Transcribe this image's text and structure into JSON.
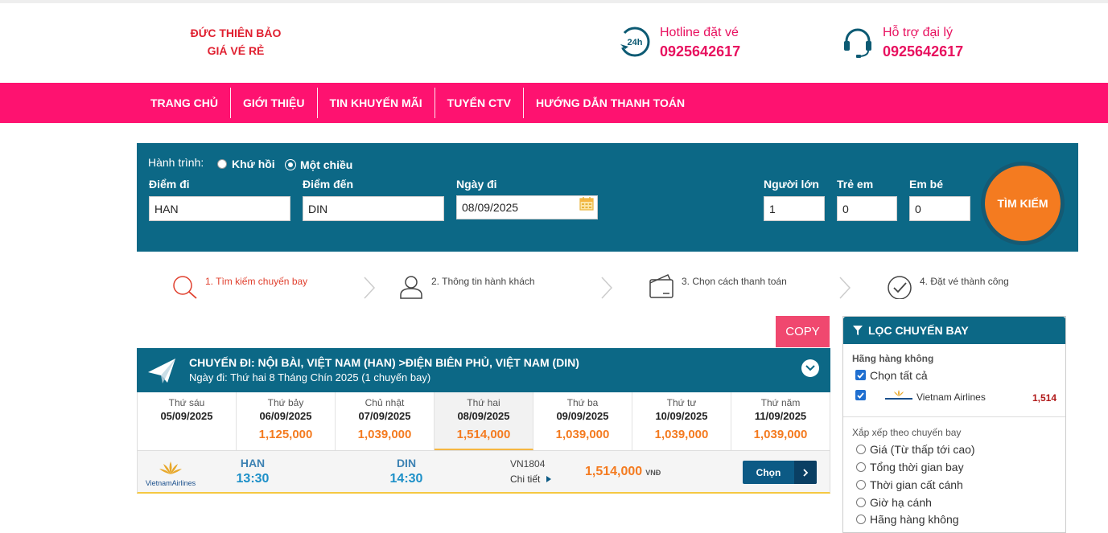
{
  "header": {
    "logo_line1": "ĐỨC THIÊN BẢO",
    "logo_line2": "GIÁ VÉ RẺ",
    "hotline_label": "Hotline đặt vé",
    "hotline_phone": "0925642617",
    "support_label": "Hỗ trợ đại lý",
    "support_phone": "0925642617",
    "hotline_icon": "24h-phone-icon",
    "support_icon": "headset-icon"
  },
  "nav": [
    "TRANG CHỦ",
    "GIỚI THIỆU",
    "TIN KHUYẾN MÃI",
    "TUYỂN CTV",
    "HƯỚNG DẪN THANH TOÁN"
  ],
  "search": {
    "trip_label": "Hành trình:",
    "round_trip": "Khứ hồi",
    "one_way": "Một chiều",
    "from_label": "Điểm đi",
    "from_value": "HAN",
    "to_label": "Điểm đến",
    "to_value": "DIN",
    "date_label": "Ngày đi",
    "date_value": "08/09/2025",
    "adult_label": "Người lớn",
    "adult_value": "1",
    "child_label": "Trẻ em",
    "child_value": "0",
    "infant_label": "Em bé",
    "infant_value": "0",
    "button": "TÌM KIẾM"
  },
  "steps": [
    "1. Tìm kiếm chuyến bay",
    "2. Thông tin hành khách",
    "3. Chọn cách thanh toán",
    "4. Đặt vé thành công"
  ],
  "copy_button": "COPY",
  "flight": {
    "title": "CHUYẾN ĐI: NỘI BÀI, VIỆT NAM (HAN) >ĐIỆN BIÊN PHỦ, VIỆT NAM (DIN)",
    "subtitle": "Ngày đi: Thứ hai 8 Tháng Chín 2025 (1 chuyến bay)",
    "days": [
      {
        "name": "Thứ sáu",
        "date": "05/09/2025",
        "price": ""
      },
      {
        "name": "Thứ bảy",
        "date": "06/09/2025",
        "price": "1,125,000"
      },
      {
        "name": "Chủ nhật",
        "date": "07/09/2025",
        "price": "1,039,000"
      },
      {
        "name": "Thứ hai",
        "date": "08/09/2025",
        "price": "1,514,000"
      },
      {
        "name": "Thứ ba",
        "date": "09/09/2025",
        "price": "1,039,000"
      },
      {
        "name": "Thứ tư",
        "date": "10/09/2025",
        "price": "1,039,000"
      },
      {
        "name": "Thứ năm",
        "date": "11/09/2025",
        "price": "1,039,000"
      }
    ],
    "row": {
      "airline": "VietnamAirlines",
      "from_code": "HAN",
      "from_time": "13:30",
      "to_code": "DIN",
      "to_time": "14:30",
      "flight_no": "VN1804",
      "details": "Chi tiết",
      "price": "1,514,000",
      "currency": "VNĐ",
      "choose": "Chọn"
    }
  },
  "filter": {
    "title": "LỌC CHUYẾN BAY",
    "airline_section": "Hãng hàng không",
    "select_all": "Chọn tất cả",
    "airline_name": "Vietnam Airlines",
    "airline_price": "1,514",
    "sort_section": "Xắp xếp theo chuyến bay",
    "sort_options": [
      "Giá (Từ thấp tới cao)",
      "Tổng thời gian bay",
      "Thời gian cất cánh",
      "Giờ hạ cánh",
      "Hãng hàng không"
    ]
  },
  "colors": {
    "brand_pink": "#fe1270",
    "header_teal": "#0c6886",
    "accent_orange": "#f47b20"
  }
}
